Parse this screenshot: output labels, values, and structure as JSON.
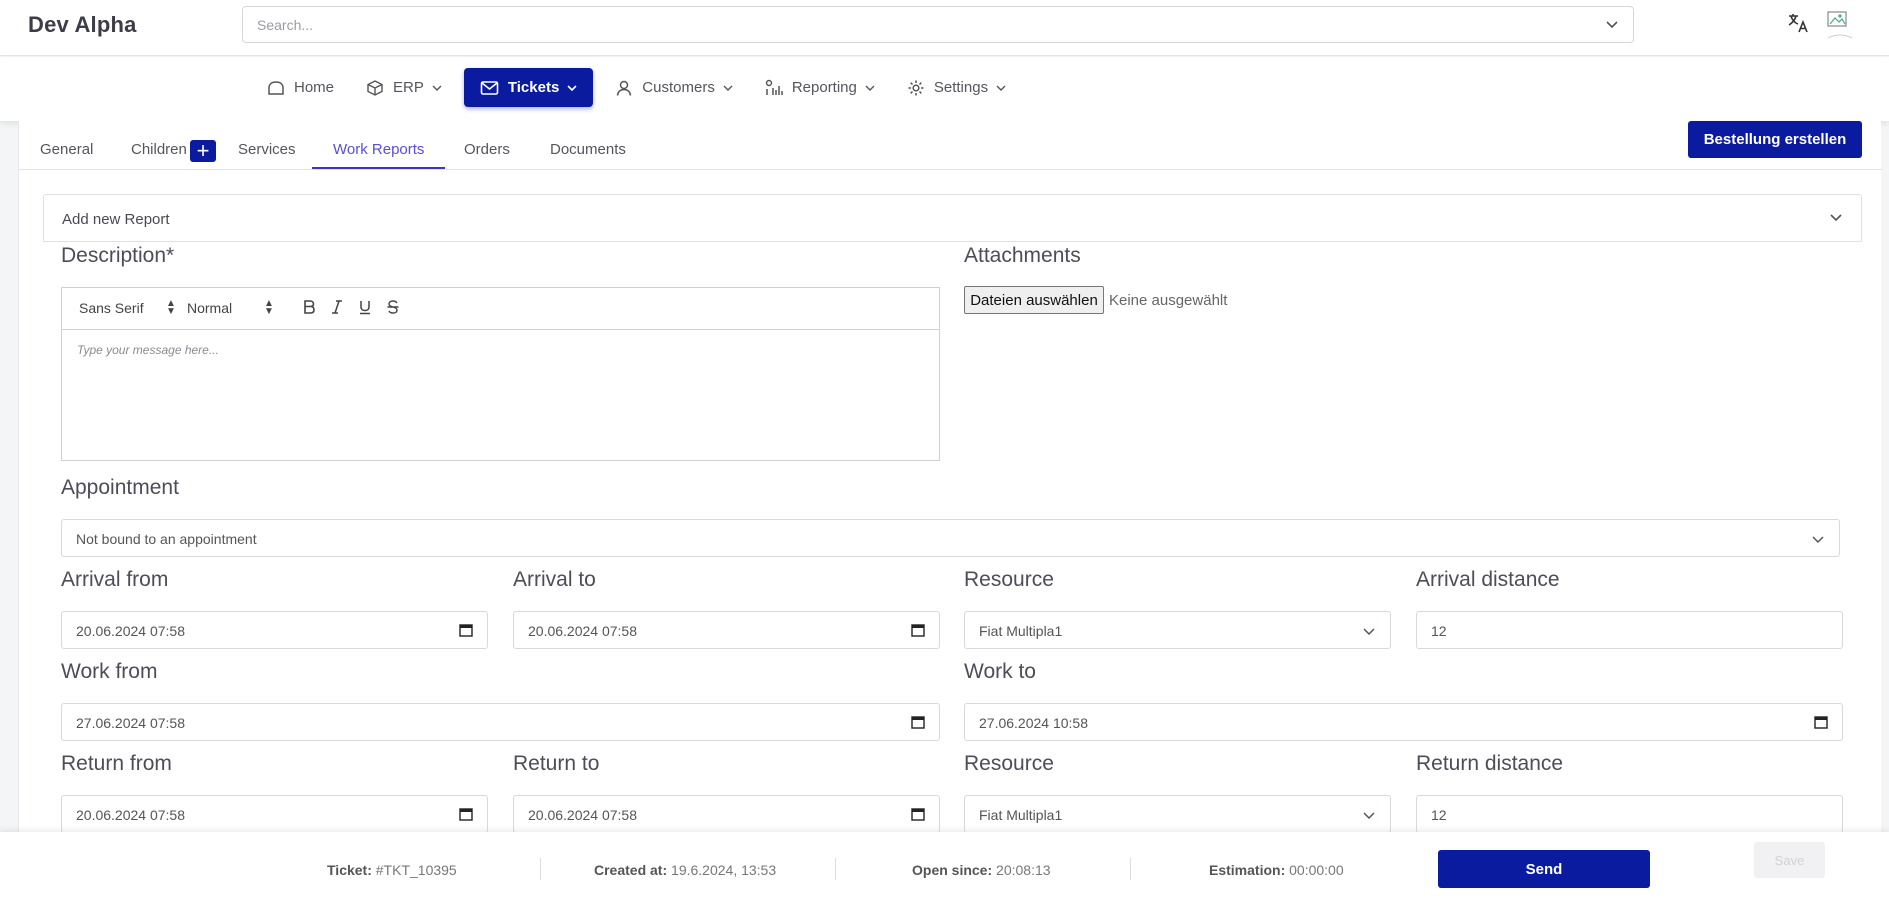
{
  "app": {
    "title": "Dev Alpha"
  },
  "search": {
    "placeholder": "Search..."
  },
  "nav": {
    "items": [
      {
        "label": "Home",
        "icon": "home-icon"
      },
      {
        "label": "ERP",
        "icon": "cube-icon"
      },
      {
        "label": "Tickets",
        "icon": "mail-icon",
        "active": true
      },
      {
        "label": "Customers",
        "icon": "user-icon"
      },
      {
        "label": "Reporting",
        "icon": "chart-icon"
      },
      {
        "label": "Settings",
        "icon": "gear-icon"
      }
    ]
  },
  "tabs": {
    "items": [
      "General",
      "Children",
      "Services",
      "Work Reports",
      "Orders",
      "Documents"
    ],
    "active": "Work Reports",
    "plus_label": "+"
  },
  "order_button": "Bestellung erstellen",
  "report": {
    "panel_title": "Add new Report",
    "description_label": "Description*",
    "attachments_label": "Attachments",
    "editor": {
      "font": "Sans Serif",
      "size": "Normal",
      "placeholder": "Type your message here..."
    },
    "file_button": "Dateien auswählen",
    "file_status": "Keine ausgewählt",
    "appointment_label": "Appointment",
    "appointment_value": "Not bound to an appointment",
    "arrival_from_label": "Arrival from",
    "arrival_from_value": "20.06.2024 07:58",
    "arrival_to_label": "Arrival to",
    "arrival_to_value": "20.06.2024 07:58",
    "resource_label": "Resource",
    "arrival_resource_value": "Fiat Multipla1",
    "arrival_distance_label": "Arrival distance",
    "arrival_distance_value": "12",
    "work_from_label": "Work from",
    "work_from_value": "27.06.2024 07:58",
    "work_to_label": "Work to",
    "work_to_value": "27.06.2024 10:58",
    "return_from_label": "Return from",
    "return_from_value": "20.06.2024 07:58",
    "return_to_label": "Return to",
    "return_to_value": "20.06.2024 07:58",
    "return_resource_value": "Fiat Multipla1",
    "return_distance_label": "Return distance",
    "return_distance_value": "12"
  },
  "footer": {
    "ticket_label": "Ticket:",
    "ticket_value": "#TKT_10395",
    "created_label": "Created at:",
    "created_value": "19.6.2024, 13:53",
    "open_label": "Open since:",
    "open_value": "20:08:13",
    "estimation_label": "Estimation:",
    "estimation_value": "00:00:00",
    "send": "Send",
    "save": "Save"
  },
  "colors": {
    "primary": "#0a1ba0",
    "active_tab": "#5a4fd0"
  }
}
